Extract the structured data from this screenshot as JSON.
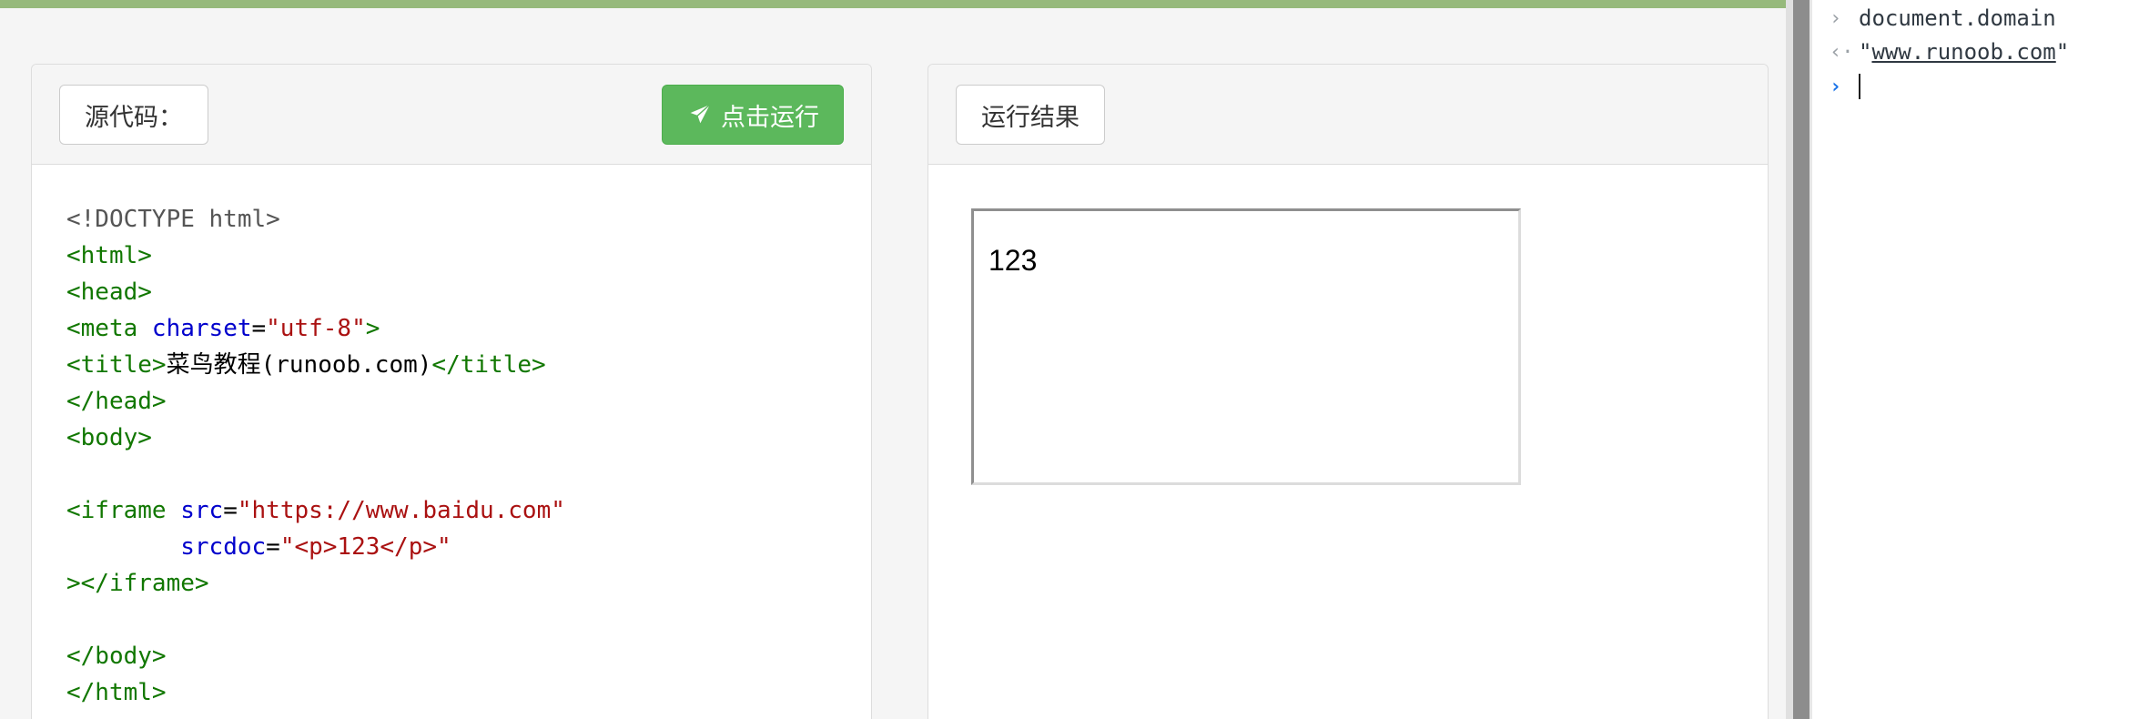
{
  "source_panel": {
    "label": "源代码：",
    "run_button": {
      "label": "点击运行",
      "icon": "paper-plane-icon"
    },
    "code_lines": [
      [
        {
          "t": "<!DOCTYPE html>",
          "c": "doctype"
        }
      ],
      [
        {
          "t": "<html>",
          "c": "tag"
        }
      ],
      [
        {
          "t": "<head>",
          "c": "tag"
        }
      ],
      [
        {
          "t": "<meta ",
          "c": "tag"
        },
        {
          "t": "charset",
          "c": "attr"
        },
        {
          "t": "=",
          "c": "plain"
        },
        {
          "t": "\"utf-8\"",
          "c": "str"
        },
        {
          "t": ">",
          "c": "tag"
        }
      ],
      [
        {
          "t": "<title>",
          "c": "tag"
        },
        {
          "t": "菜鸟教程(runoob.com)",
          "c": "plain"
        },
        {
          "t": "</title>",
          "c": "tag"
        }
      ],
      [
        {
          "t": "</head>",
          "c": "tag"
        }
      ],
      [
        {
          "t": "<body>",
          "c": "tag"
        }
      ],
      [],
      [
        {
          "t": "<iframe ",
          "c": "tag"
        },
        {
          "t": "src",
          "c": "attr"
        },
        {
          "t": "=",
          "c": "plain"
        },
        {
          "t": "\"https://www.baidu.com\"",
          "c": "str"
        }
      ],
      [
        {
          "t": "        ",
          "c": "plain"
        },
        {
          "t": "srcdoc",
          "c": "attr"
        },
        {
          "t": "=",
          "c": "plain"
        },
        {
          "t": "\"<p>123</p>\"",
          "c": "str"
        }
      ],
      [
        {
          "t": "></iframe>",
          "c": "tag"
        }
      ],
      [],
      [
        {
          "t": "</body>",
          "c": "tag"
        }
      ],
      [
        {
          "t": "</html>",
          "c": "tag"
        }
      ]
    ]
  },
  "result_panel": {
    "label": "运行结果",
    "iframe_text": "123"
  },
  "console": {
    "input_command": "document.domain",
    "output_value": "www.runoob.com"
  },
  "colors": {
    "top_bar": "#96b97b",
    "run_button": "#5cb85c",
    "code_tag": "#117700",
    "code_attr": "#0000cc",
    "code_string": "#aa1111"
  }
}
